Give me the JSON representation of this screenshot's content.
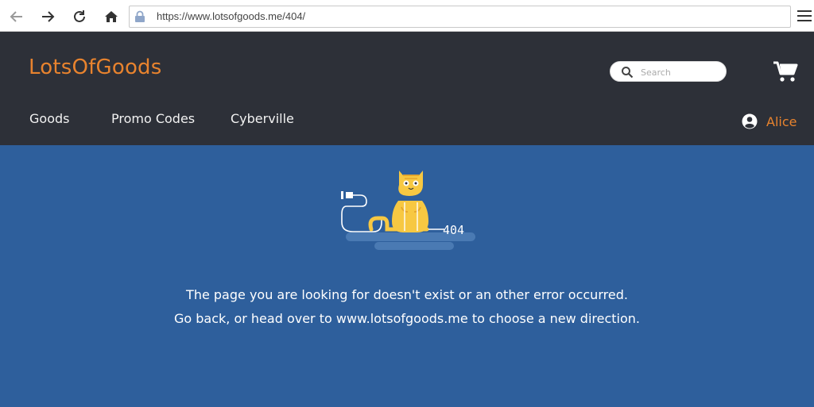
{
  "browser": {
    "url": "https://www.lotsofgoods.me/404/",
    "icons": [
      "back-arrow-icon",
      "forward-arrow-icon",
      "reload-icon",
      "home-icon",
      "lock-icon",
      "hamburger-menu-icon"
    ]
  },
  "header": {
    "logo": "LotsOfGoods",
    "search_placeholder": "Search",
    "nav": [
      {
        "label": "Goods"
      },
      {
        "label": "Promo Codes"
      },
      {
        "label": "Cyberville"
      }
    ],
    "user_name": "Alice",
    "colors": {
      "background": "#2d3038",
      "accent": "#e8832e",
      "text": "#f2f2f2"
    }
  },
  "main": {
    "error_code": "404",
    "message_line1": "The page you are looking for doesn't exist or an other error occurred.",
    "message_line2": "Go back, or head over to www.lotsofgoods.me to choose a new direction.",
    "colors": {
      "background": "#2e5f9c",
      "cat": "#f7c842"
    }
  }
}
